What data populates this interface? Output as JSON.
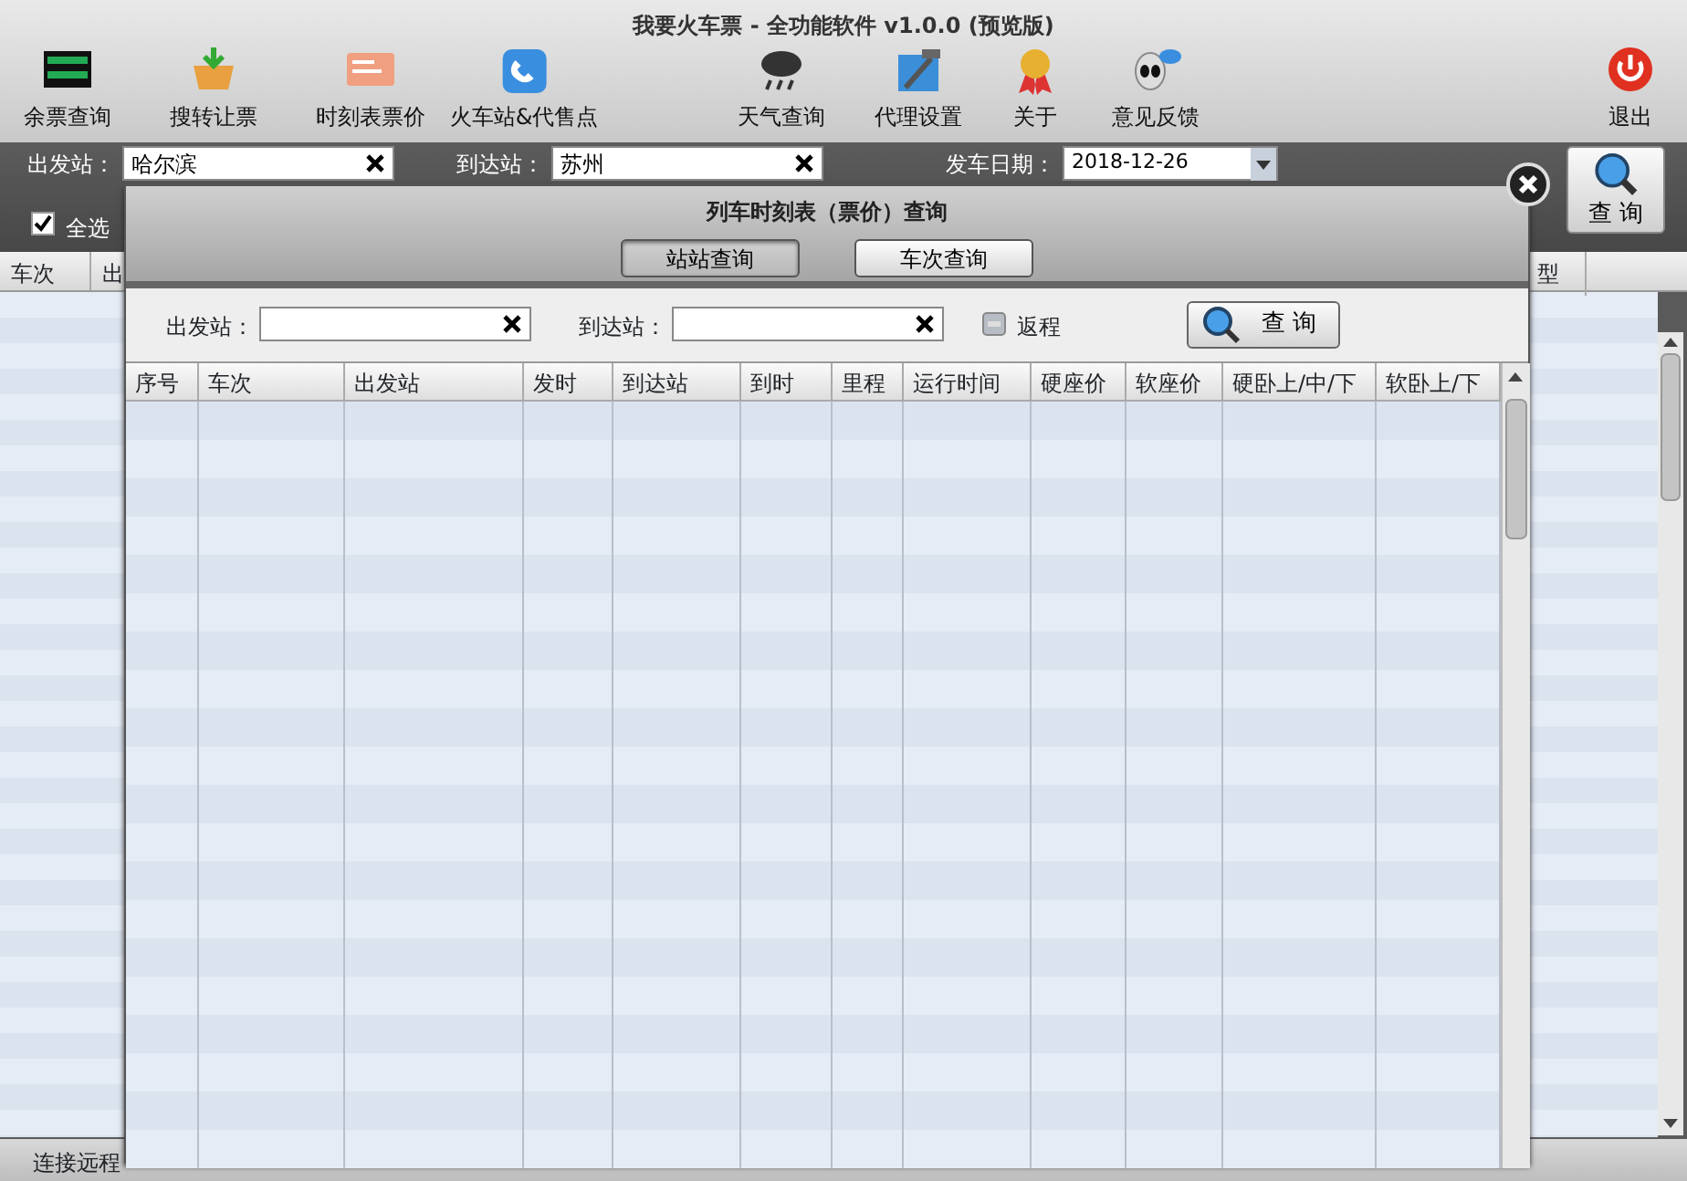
{
  "window": {
    "title": "我要火车票 - 全功能软件 v1.0.0 (预览版)"
  },
  "toolbar": [
    {
      "label": "余票查询",
      "kind": "board"
    },
    {
      "label": "搜转让票",
      "kind": "basket"
    },
    {
      "label": "时刻表票价",
      "kind": "ticket"
    },
    {
      "label": "火车站&代售点",
      "kind": "phone"
    },
    {
      "label": "天气查询",
      "kind": "weather"
    },
    {
      "label": "代理设置",
      "kind": "tools"
    },
    {
      "label": "关于",
      "kind": "medal"
    },
    {
      "label": "意见反馈",
      "kind": "chat"
    },
    {
      "label": "退出",
      "kind": "power"
    }
  ],
  "filters": {
    "departure": {
      "label": "出发站：",
      "value": "哈尔滨"
    },
    "arrival": {
      "label": "到达站：",
      "value": "苏州"
    },
    "date": {
      "label": "发车日期：",
      "value": "2018-12-26"
    },
    "select_all": {
      "label": "全选",
      "checked": true
    }
  },
  "search_button": "查 询",
  "main_table": {
    "columns": [
      "车次",
      "出",
      "型"
    ]
  },
  "dialog": {
    "title": "列车时刻表（票价）查询",
    "tabs": [
      {
        "label": "站站查询",
        "selected": true
      },
      {
        "label": "车次查询",
        "selected": false
      }
    ],
    "departure_label": "出发站：",
    "arrival_label": "到达站：",
    "return_trip": {
      "label": "返程",
      "checked": false
    },
    "search_button": "查 询",
    "columns": [
      "序号",
      "车次",
      "出发站",
      "发时",
      "到达站",
      "到时",
      "里程",
      "运行时间",
      "硬座价",
      "软座价",
      "硬卧上/中/下",
      "软卧上/下"
    ]
  },
  "status_bar": "连接远程"
}
